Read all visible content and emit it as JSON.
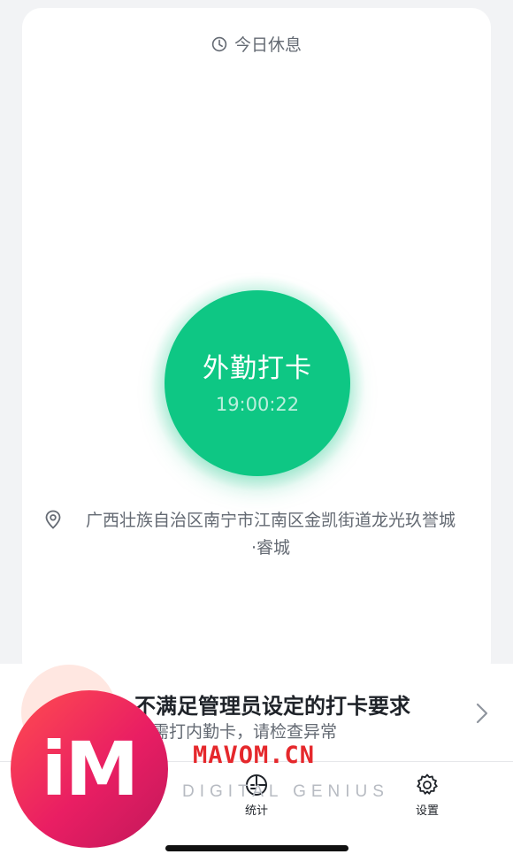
{
  "card": {
    "day_status": "今日休息",
    "punch_button": {
      "label": "外勤打卡",
      "time": "19:00:22"
    },
    "location": {
      "line1": "广西壮族自治区南宁市江南区金凯街道龙光玖誉城",
      "line2": "·睿城"
    }
  },
  "alert": {
    "title": "不满足管理员设定的打卡要求",
    "subtitle": "需打内勤卡，请检查异常"
  },
  "tabbar": {
    "items": [
      {
        "label": "统计",
        "icon": "stats-icon"
      },
      {
        "label": "设置",
        "icon": "gear-icon"
      }
    ]
  },
  "watermark": {
    "logo": "iM",
    "site": "MAVOM.CN",
    "tagline": "DIGITAL GENIUS"
  },
  "colors": {
    "accent": "#0ec784",
    "alert_red": "#e5282c"
  }
}
